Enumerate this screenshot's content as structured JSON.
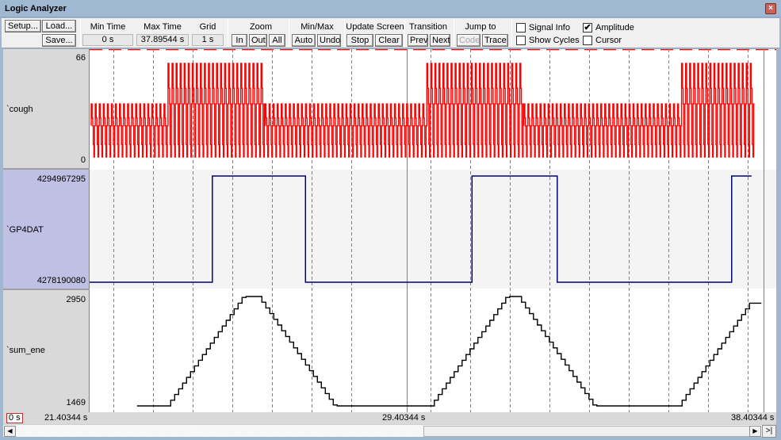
{
  "window": {
    "title": "Logic Analyzer",
    "close_icon": "close-icon"
  },
  "toolbar": {
    "setup": "Setup...",
    "load": "Load...",
    "save": "Save...",
    "min_time": {
      "label": "Min Time",
      "value": "0 s"
    },
    "max_time": {
      "label": "Max Time",
      "value": "37.89544 s"
    },
    "grid": {
      "label": "Grid",
      "value": "1 s"
    },
    "zoom": {
      "label": "Zoom",
      "in": "In",
      "out": "Out",
      "all": "All"
    },
    "minmax": {
      "label": "Min/Max",
      "auto": "Auto",
      "undo": "Undo"
    },
    "update_screen": {
      "label": "Update Screen",
      "stop": "Stop",
      "clear": "Clear"
    },
    "transition": {
      "label": "Transition",
      "prev": "Prev",
      "next": "Next"
    },
    "jump_to": {
      "label": "Jump to",
      "code": "Code",
      "trace": "Trace"
    },
    "options": {
      "signal_info": {
        "label": "Signal Info",
        "checked": false
      },
      "amplitude": {
        "label": "Amplitude",
        "checked": true
      },
      "show_cycles": {
        "label": "Show Cycles",
        "checked": false
      },
      "cursor": {
        "label": "Cursor",
        "checked": false
      }
    },
    "check_glyph": "✔"
  },
  "signals": [
    {
      "name": "`cough",
      "max": "66",
      "min": "0",
      "color": "#ff0000",
      "selected": false
    },
    {
      "name": "`GP4DAT",
      "max": "4294967295",
      "min": "4278190080",
      "color": "#000080",
      "selected": true
    },
    {
      "name": "`sum_ene",
      "max": "2950",
      "min": "1469",
      "color": "#000000",
      "selected": false
    }
  ],
  "timeline": {
    "origin_label": "0 s",
    "start": "21.40344 s",
    "cursor": "29.40344 s",
    "end": "38.40344 s",
    "start_value": 21.40344,
    "end_value": 38.40344,
    "cursor_value": 29.40344,
    "grid_step_s": 1
  },
  "waveforms": {
    "gp4dat_transitions_s": [
      {
        "t": 21.40344,
        "level": "low"
      },
      {
        "t": 24.5,
        "level": "high"
      },
      {
        "t": 26.85,
        "level": "low"
      },
      {
        "t": 31.05,
        "level": "high"
      },
      {
        "t": 33.2,
        "level": "low"
      },
      {
        "t": 37.6,
        "level": "high"
      }
    ],
    "cough_bursts_s": [
      {
        "from": 23.3,
        "to": 25.75,
        "amplitude": "high"
      },
      {
        "from": 29.85,
        "to": 32.3,
        "amplitude": "high"
      },
      {
        "from": 36.25,
        "to": 38.1,
        "amplitude": "high"
      }
    ],
    "sum_ene_peaks_s": [
      25.6,
      32.15
    ],
    "sum_ene_valleys_s": [
      {
        "from": 28.15,
        "to": 30.1
      },
      {
        "from": 34.5,
        "to": 36.35
      }
    ]
  },
  "scrollbar": {
    "left_arrow": "◀",
    "right_arrow": "▶",
    "end_button": ">|"
  }
}
